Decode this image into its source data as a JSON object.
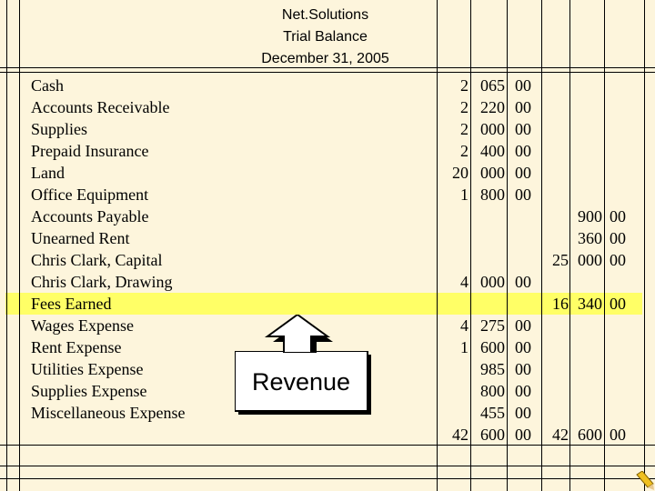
{
  "heading": {
    "company": "Net.Solutions",
    "title": "Trial Balance",
    "date": "December 31, 2005"
  },
  "accounts": [
    {
      "name": "Cash",
      "dr_a": "2",
      "dr_b": "065",
      "dr_c": "00",
      "cr_a": "",
      "cr_b": "",
      "cr_c": ""
    },
    {
      "name": "Accounts Receivable",
      "dr_a": "2",
      "dr_b": "220",
      "dr_c": "00",
      "cr_a": "",
      "cr_b": "",
      "cr_c": ""
    },
    {
      "name": "Supplies",
      "dr_a": "2",
      "dr_b": "000",
      "dr_c": "00",
      "cr_a": "",
      "cr_b": "",
      "cr_c": ""
    },
    {
      "name": "Prepaid Insurance",
      "dr_a": "2",
      "dr_b": "400",
      "dr_c": "00",
      "cr_a": "",
      "cr_b": "",
      "cr_c": ""
    },
    {
      "name": "Land",
      "dr_a": "20",
      "dr_b": "000",
      "dr_c": "00",
      "cr_a": "",
      "cr_b": "",
      "cr_c": ""
    },
    {
      "name": "Office Equipment",
      "dr_a": "1",
      "dr_b": "800",
      "dr_c": "00",
      "cr_a": "",
      "cr_b": "",
      "cr_c": ""
    },
    {
      "name": "Accounts Payable",
      "dr_a": "",
      "dr_b": "",
      "dr_c": "",
      "cr_a": "",
      "cr_b": "900",
      "cr_c": "00"
    },
    {
      "name": "Unearned Rent",
      "dr_a": "",
      "dr_b": "",
      "dr_c": "",
      "cr_a": "",
      "cr_b": "360",
      "cr_c": "00"
    },
    {
      "name": "Chris Clark, Capital",
      "dr_a": "",
      "dr_b": "",
      "dr_c": "",
      "cr_a": "25",
      "cr_b": "000",
      "cr_c": "00"
    },
    {
      "name": "Chris Clark, Drawing",
      "dr_a": "4",
      "dr_b": "000",
      "dr_c": "00",
      "cr_a": "",
      "cr_b": "",
      "cr_c": ""
    },
    {
      "name": "Fees Earned",
      "dr_a": "",
      "dr_b": "",
      "dr_c": "",
      "cr_a": "16",
      "cr_b": "340",
      "cr_c": "00"
    },
    {
      "name": "Wages Expense",
      "dr_a": "4",
      "dr_b": "275",
      "dr_c": "00",
      "cr_a": "",
      "cr_b": "",
      "cr_c": ""
    },
    {
      "name": "Rent Expense",
      "dr_a": "1",
      "dr_b": "600",
      "dr_c": "00",
      "cr_a": "",
      "cr_b": "",
      "cr_c": ""
    },
    {
      "name": "Utilities Expense",
      "dr_a": "",
      "dr_b": "985",
      "dr_c": "00",
      "cr_a": "",
      "cr_b": "",
      "cr_c": ""
    },
    {
      "name": "Supplies Expense",
      "dr_a": "",
      "dr_b": "800",
      "dr_c": "00",
      "cr_a": "",
      "cr_b": "",
      "cr_c": ""
    },
    {
      "name": "Miscellaneous Expense",
      "dr_a": "",
      "dr_b": "455",
      "dr_c": "00",
      "cr_a": "",
      "cr_b": "",
      "cr_c": ""
    }
  ],
  "totals": {
    "debit": {
      "a": "42",
      "b": "600",
      "cents": "00"
    },
    "credit": {
      "a": "42",
      "b": "600",
      "cents": "00"
    }
  },
  "callout": {
    "label": "Revenue"
  },
  "colors": {
    "background": "#fdf5dc",
    "highlight": "#ffff66"
  }
}
